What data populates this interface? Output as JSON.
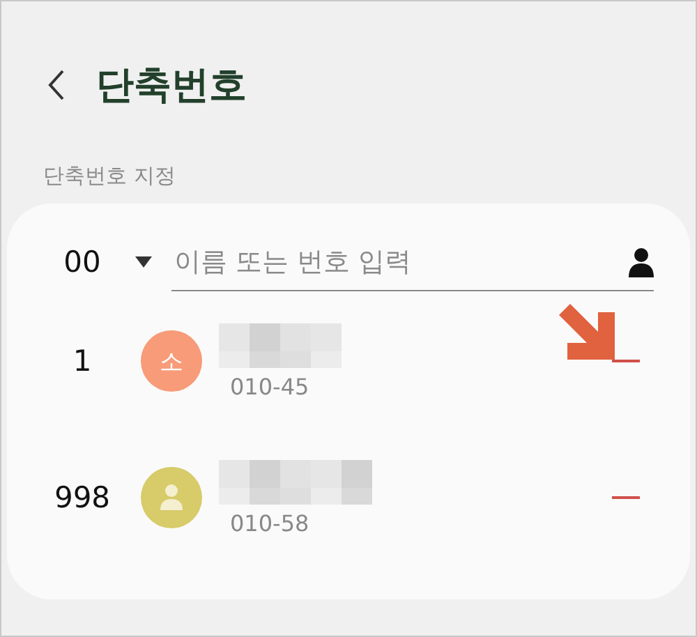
{
  "header": {
    "title": "단축번호"
  },
  "section_label": "단축번호 지정",
  "entry": {
    "number": "00",
    "placeholder": "이름 또는 번호 입력"
  },
  "contacts": [
    {
      "speed_dial": "1",
      "kind": "initial",
      "initial": "소",
      "color": "#f79b79",
      "phone": "010-45",
      "pointed_at": true
    },
    {
      "speed_dial": "998",
      "kind": "person",
      "color": "#d7cb6a",
      "phone": "010-58",
      "pointed_at": false
    }
  ]
}
